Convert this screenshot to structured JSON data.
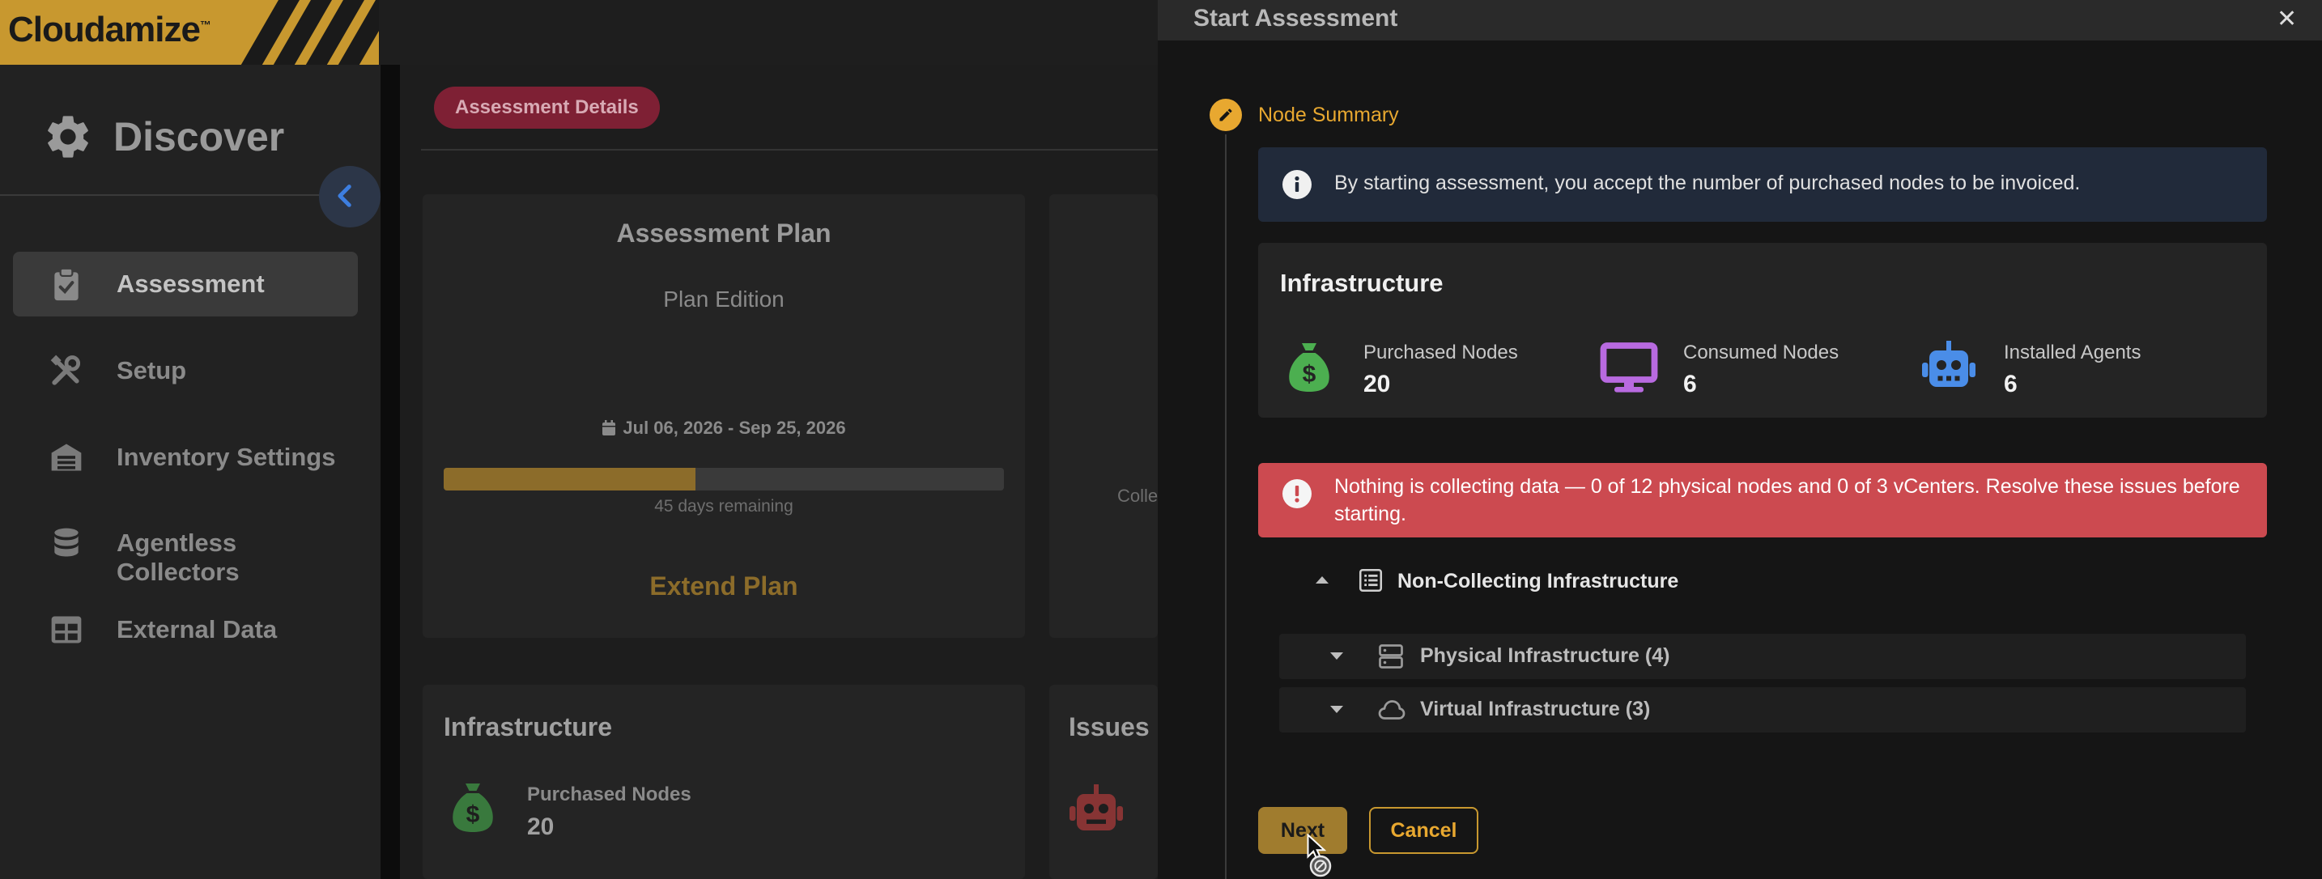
{
  "app": {
    "logo_text": "Cloudamize",
    "trademark": "™"
  },
  "sidebar": {
    "section_title": "Discover",
    "items": [
      {
        "label": "Assessment",
        "icon": "clipboard-check-icon",
        "active": true
      },
      {
        "label": "Setup",
        "icon": "tools-icon",
        "active": false
      },
      {
        "label": "Inventory Settings",
        "icon": "warehouse-icon",
        "active": false
      },
      {
        "label": "Agentless Collectors",
        "icon": "database-icon",
        "active": false
      },
      {
        "label": "External Data",
        "icon": "table-icon",
        "active": false
      }
    ]
  },
  "main": {
    "tab_pill": "Assessment Details",
    "plan_card": {
      "title": "Assessment Plan",
      "edition": "Plan Edition",
      "dates": "Jul 06, 2026 - Sep 25, 2026",
      "progress_fraction": 0.45,
      "days_remaining": "45 days remaining",
      "extend_label": "Extend Plan"
    },
    "partial_text": "Colle",
    "infra_card": {
      "title": "Infrastructure",
      "purchased_label": "Purchased Nodes",
      "purchased_value": "20"
    },
    "issues_title": "Issues"
  },
  "modal": {
    "title": "Start Assessment",
    "close_symbol": "✕",
    "step_label": "Node Summary",
    "info_text": "By starting assessment, you accept the number of purchased nodes to be invoiced.",
    "infra": {
      "title": "Infrastructure",
      "stats": [
        {
          "label": "Purchased Nodes",
          "value": "20",
          "icon": "money-bag-icon",
          "color": "#4caf50"
        },
        {
          "label": "Consumed Nodes",
          "value": "6",
          "icon": "monitor-icon",
          "color": "#b86ae0"
        },
        {
          "label": "Installed Agents",
          "value": "6",
          "icon": "robot-icon",
          "color": "#4a8de8"
        }
      ]
    },
    "error_text": "Nothing is collecting data — 0 of 12 physical nodes and 0 of 3 vCenters. Resolve these issues before starting.",
    "tree": {
      "root_label": "Non-Collecting Infrastructure",
      "children": [
        {
          "label": "Physical Infrastructure (4)",
          "icon": "server-icon"
        },
        {
          "label": "Virtual Infrastructure (3)",
          "icon": "cloud-icon"
        }
      ]
    },
    "buttons": {
      "next": "Next",
      "cancel": "Cancel"
    }
  },
  "colors": {
    "brand_gold": "#c8982f",
    "accent_orange": "#e8a830",
    "error_red": "#cc4a50",
    "info_bg": "#212a3a",
    "pill_bg": "#7e2034"
  }
}
